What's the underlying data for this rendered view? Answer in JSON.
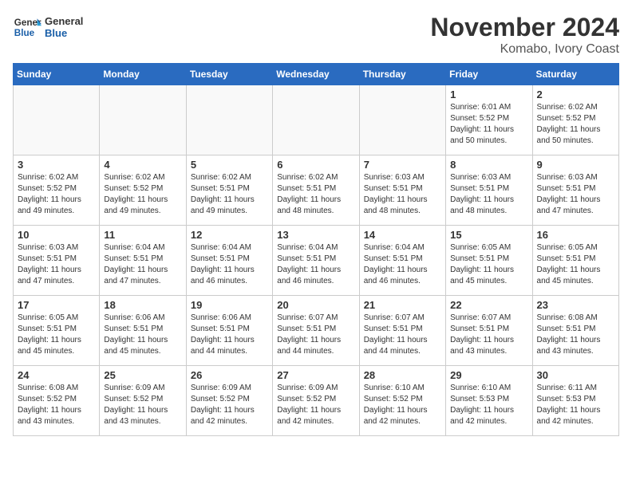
{
  "header": {
    "logo_line1": "General",
    "logo_line2": "Blue",
    "month_title": "November 2024",
    "location": "Komabo, Ivory Coast"
  },
  "weekdays": [
    "Sunday",
    "Monday",
    "Tuesday",
    "Wednesday",
    "Thursday",
    "Friday",
    "Saturday"
  ],
  "weeks": [
    [
      {
        "day": "",
        "info": ""
      },
      {
        "day": "",
        "info": ""
      },
      {
        "day": "",
        "info": ""
      },
      {
        "day": "",
        "info": ""
      },
      {
        "day": "",
        "info": ""
      },
      {
        "day": "1",
        "info": "Sunrise: 6:01 AM\nSunset: 5:52 PM\nDaylight: 11 hours\nand 50 minutes."
      },
      {
        "day": "2",
        "info": "Sunrise: 6:02 AM\nSunset: 5:52 PM\nDaylight: 11 hours\nand 50 minutes."
      }
    ],
    [
      {
        "day": "3",
        "info": "Sunrise: 6:02 AM\nSunset: 5:52 PM\nDaylight: 11 hours\nand 49 minutes."
      },
      {
        "day": "4",
        "info": "Sunrise: 6:02 AM\nSunset: 5:52 PM\nDaylight: 11 hours\nand 49 minutes."
      },
      {
        "day": "5",
        "info": "Sunrise: 6:02 AM\nSunset: 5:51 PM\nDaylight: 11 hours\nand 49 minutes."
      },
      {
        "day": "6",
        "info": "Sunrise: 6:02 AM\nSunset: 5:51 PM\nDaylight: 11 hours\nand 48 minutes."
      },
      {
        "day": "7",
        "info": "Sunrise: 6:03 AM\nSunset: 5:51 PM\nDaylight: 11 hours\nand 48 minutes."
      },
      {
        "day": "8",
        "info": "Sunrise: 6:03 AM\nSunset: 5:51 PM\nDaylight: 11 hours\nand 48 minutes."
      },
      {
        "day": "9",
        "info": "Sunrise: 6:03 AM\nSunset: 5:51 PM\nDaylight: 11 hours\nand 47 minutes."
      }
    ],
    [
      {
        "day": "10",
        "info": "Sunrise: 6:03 AM\nSunset: 5:51 PM\nDaylight: 11 hours\nand 47 minutes."
      },
      {
        "day": "11",
        "info": "Sunrise: 6:04 AM\nSunset: 5:51 PM\nDaylight: 11 hours\nand 47 minutes."
      },
      {
        "day": "12",
        "info": "Sunrise: 6:04 AM\nSunset: 5:51 PM\nDaylight: 11 hours\nand 46 minutes."
      },
      {
        "day": "13",
        "info": "Sunrise: 6:04 AM\nSunset: 5:51 PM\nDaylight: 11 hours\nand 46 minutes."
      },
      {
        "day": "14",
        "info": "Sunrise: 6:04 AM\nSunset: 5:51 PM\nDaylight: 11 hours\nand 46 minutes."
      },
      {
        "day": "15",
        "info": "Sunrise: 6:05 AM\nSunset: 5:51 PM\nDaylight: 11 hours\nand 45 minutes."
      },
      {
        "day": "16",
        "info": "Sunrise: 6:05 AM\nSunset: 5:51 PM\nDaylight: 11 hours\nand 45 minutes."
      }
    ],
    [
      {
        "day": "17",
        "info": "Sunrise: 6:05 AM\nSunset: 5:51 PM\nDaylight: 11 hours\nand 45 minutes."
      },
      {
        "day": "18",
        "info": "Sunrise: 6:06 AM\nSunset: 5:51 PM\nDaylight: 11 hours\nand 45 minutes."
      },
      {
        "day": "19",
        "info": "Sunrise: 6:06 AM\nSunset: 5:51 PM\nDaylight: 11 hours\nand 44 minutes."
      },
      {
        "day": "20",
        "info": "Sunrise: 6:07 AM\nSunset: 5:51 PM\nDaylight: 11 hours\nand 44 minutes."
      },
      {
        "day": "21",
        "info": "Sunrise: 6:07 AM\nSunset: 5:51 PM\nDaylight: 11 hours\nand 44 minutes."
      },
      {
        "day": "22",
        "info": "Sunrise: 6:07 AM\nSunset: 5:51 PM\nDaylight: 11 hours\nand 43 minutes."
      },
      {
        "day": "23",
        "info": "Sunrise: 6:08 AM\nSunset: 5:51 PM\nDaylight: 11 hours\nand 43 minutes."
      }
    ],
    [
      {
        "day": "24",
        "info": "Sunrise: 6:08 AM\nSunset: 5:52 PM\nDaylight: 11 hours\nand 43 minutes."
      },
      {
        "day": "25",
        "info": "Sunrise: 6:09 AM\nSunset: 5:52 PM\nDaylight: 11 hours\nand 43 minutes."
      },
      {
        "day": "26",
        "info": "Sunrise: 6:09 AM\nSunset: 5:52 PM\nDaylight: 11 hours\nand 42 minutes."
      },
      {
        "day": "27",
        "info": "Sunrise: 6:09 AM\nSunset: 5:52 PM\nDaylight: 11 hours\nand 42 minutes."
      },
      {
        "day": "28",
        "info": "Sunrise: 6:10 AM\nSunset: 5:52 PM\nDaylight: 11 hours\nand 42 minutes."
      },
      {
        "day": "29",
        "info": "Sunrise: 6:10 AM\nSunset: 5:53 PM\nDaylight: 11 hours\nand 42 minutes."
      },
      {
        "day": "30",
        "info": "Sunrise: 6:11 AM\nSunset: 5:53 PM\nDaylight: 11 hours\nand 42 minutes."
      }
    ]
  ]
}
